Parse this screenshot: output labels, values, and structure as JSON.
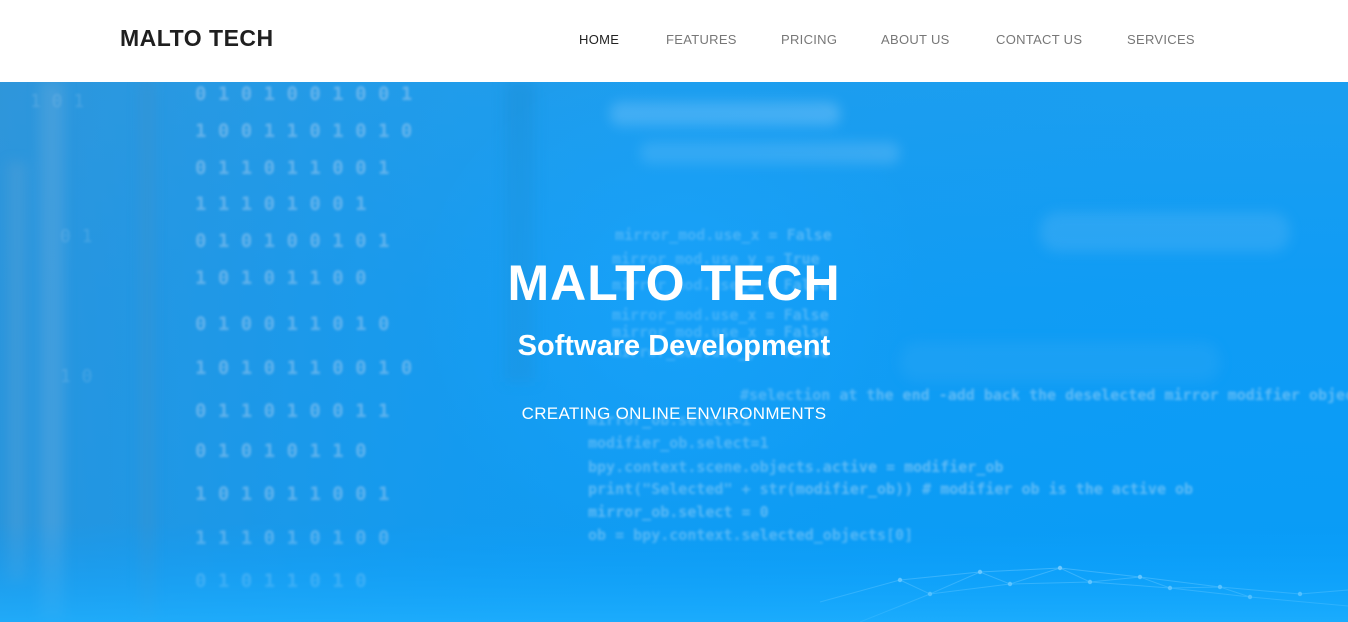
{
  "navbar": {
    "brand": "MALTO TECH",
    "links": [
      {
        "label": "HOME",
        "active": true
      },
      {
        "label": "FEATURES",
        "active": false
      },
      {
        "label": "PRICING",
        "active": false
      },
      {
        "label": "ABOUT US",
        "active": false
      },
      {
        "label": "CONTACT US",
        "active": false
      },
      {
        "label": "SERVICES",
        "active": false
      }
    ]
  },
  "hero": {
    "title": "MALTO TECH",
    "subtitle": "Software Development",
    "tagline": "CREATING ONLINE ENVIRONMENTS"
  },
  "colors": {
    "navbar_bg": "#ffffff",
    "brand_text": "#1f1f1f",
    "nav_text": "#777777",
    "nav_active_text": "#222222",
    "hero_blue": "#0f9cf5",
    "hero_text": "#ffffff"
  }
}
